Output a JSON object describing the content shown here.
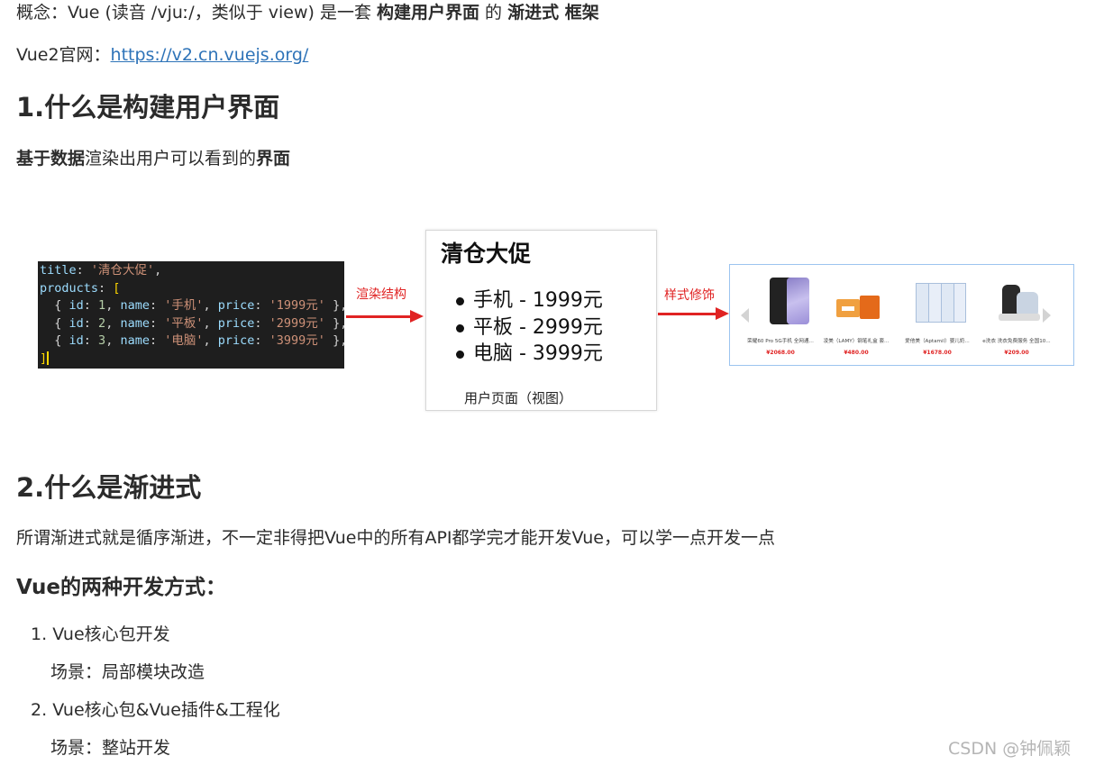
{
  "intro": {
    "concept_prefix": "概念：Vue (读音 /vjuː/，类似于 view) 是一套 ",
    "concept_bold1": "构建用户界面",
    "concept_mid": " 的 ",
    "concept_bold2": "渐进式 框架",
    "site_label": "Vue2官网：",
    "site_link": "https://v2.cn.vuejs.org/"
  },
  "section1": {
    "heading": "1.什么是构建用户界面",
    "desc_bold1": "基于数据",
    "desc_mid": "渲染出用户可以看到的",
    "desc_bold2": "界面"
  },
  "diagram": {
    "code_lines": [
      "title: '清仓大促',",
      "products: [",
      "  { id: 1, name: '手机', price: '1999元' },",
      "  { id: 2, name: '平板', price: '2999元' },",
      "  { id: 3, name: '电脑', price: '3999元' },",
      "]"
    ],
    "arrow1_label": "渲染结构",
    "arrow2_label": "样式修饰",
    "view_title": "清仓大促",
    "view_items": [
      "手机 - 1999元",
      "平板 - 2999元",
      "电脑 - 3999元"
    ],
    "view_caption": "用户页面（视图）",
    "products": [
      {
        "name": "荣耀60 Pro 5G手机 全网通...",
        "price": "¥2068.00",
        "icon": "smartphone-icon"
      },
      {
        "name": "凌美（LAMY）钢笔礼盒 套...",
        "price": "¥480.00",
        "icon": "gift-box-icon"
      },
      {
        "name": "爱他美（Aptamil）婴儿奶...",
        "price": "¥1678.00",
        "icon": "milk-powder-icon"
      },
      {
        "name": "e洗衣 洗衣免费服务 全国10...",
        "price": "¥209.00",
        "icon": "laundry-icon"
      }
    ]
  },
  "section2": {
    "heading": "2.什么是渐进式",
    "desc": "所谓渐进式就是循序渐进，不一定非得把Vue中的所有API都学完才能开发Vue，可以学一点开发一点",
    "sub_heading": "Vue的两种开发方式：",
    "ways": [
      {
        "num": "1.",
        "title": "Vue核心包开发",
        "scene": "场景：局部模块改造"
      },
      {
        "num": "2.",
        "title": "Vue核心包&Vue插件&工程化",
        "scene": "场景：整站开发"
      }
    ]
  },
  "watermark": "CSDN @钟佩颖",
  "colors": {
    "accent_red": "#e02323",
    "link_blue": "#2e73b8",
    "code_bg": "#1e1e1e"
  }
}
